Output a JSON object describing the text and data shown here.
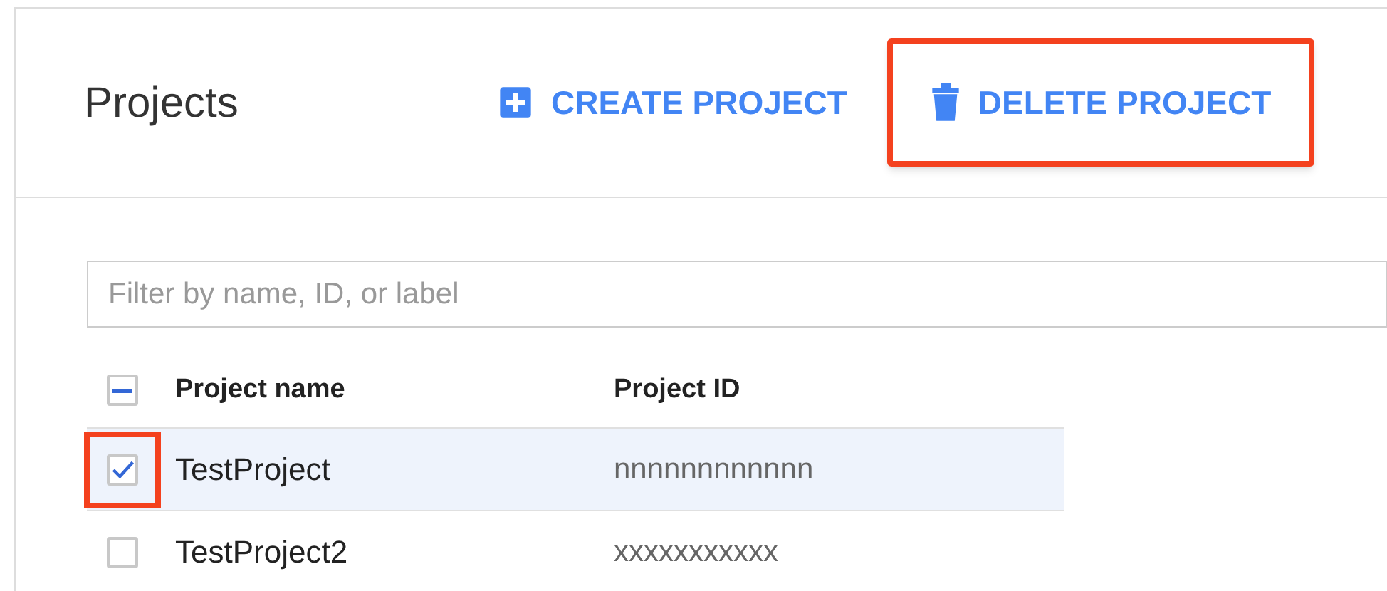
{
  "title": "Projects",
  "actions": [
    {
      "label": "CREATE PROJECT",
      "kind": "create",
      "highlighted": false
    },
    {
      "label": "DELETE PROJECT",
      "kind": "delete",
      "highlighted": true
    }
  ],
  "filter": {
    "placeholder": "Filter by name, ID, or label"
  },
  "table": {
    "select_all": {
      "indeterminate": true
    },
    "columns": [
      "Project name",
      "Project ID"
    ],
    "rows": [
      {
        "name": "TestProject",
        "id": "nnnnnnnnnnnn",
        "selected": true,
        "highlighted": true
      },
      {
        "name": "TestProject2",
        "id": "xxxxxxxxxxx",
        "selected": false,
        "highlighted": false
      }
    ]
  }
}
